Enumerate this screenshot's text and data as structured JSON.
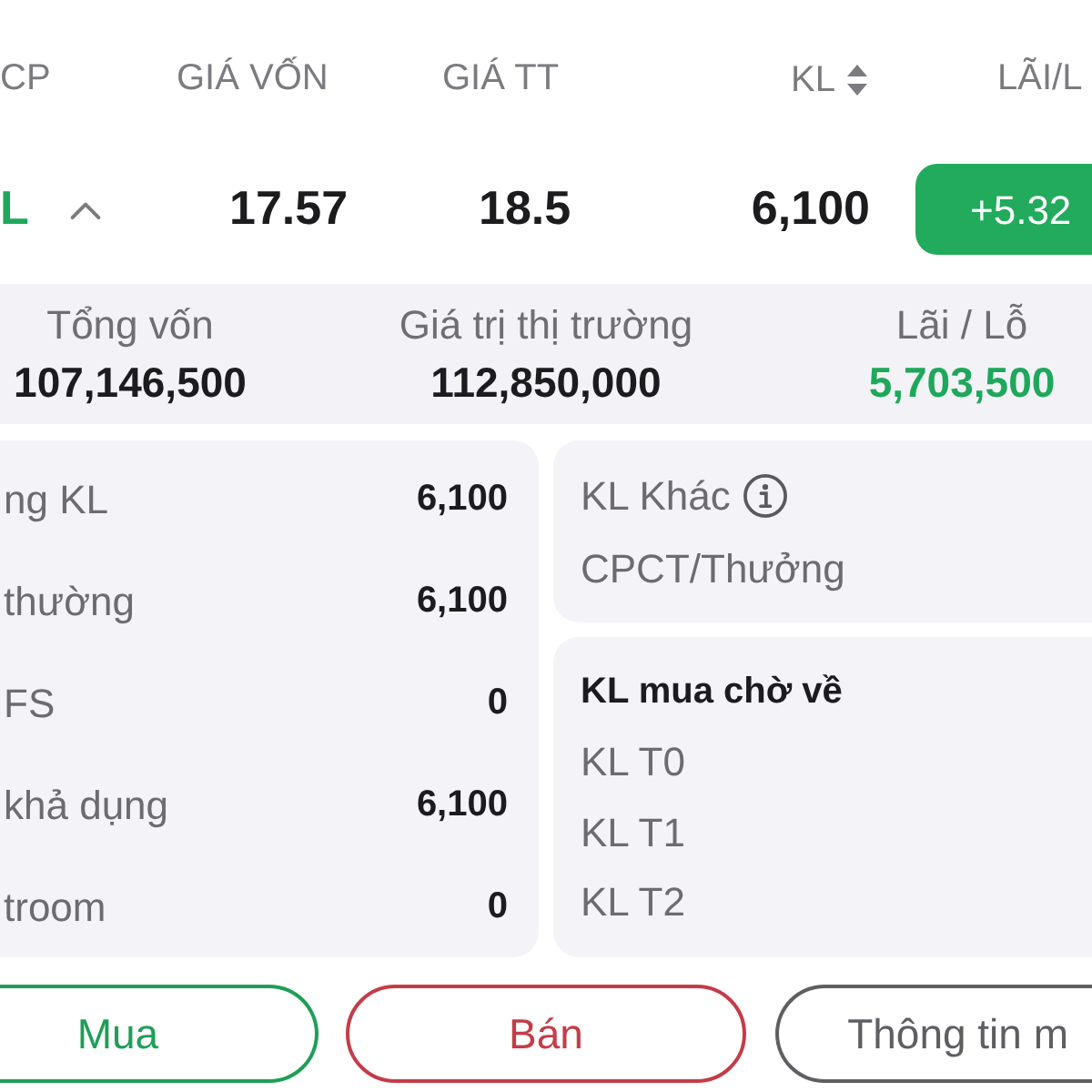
{
  "table": {
    "columns": [
      {
        "label": "CP",
        "sortable": false
      },
      {
        "label": "GIÁ VỐN",
        "sortable": false
      },
      {
        "label": "GIÁ TT",
        "sortable": false
      },
      {
        "label": "KL",
        "sortable": true
      },
      {
        "label": "LÃI/L",
        "sortable": false
      }
    ],
    "rows": [
      {
        "symbol": "L",
        "gain": true,
        "expanded": true,
        "cost_price": "17.57",
        "market_price": "18.5",
        "volume": "6,100",
        "change": "+5.32"
      }
    ]
  },
  "summary": [
    {
      "label": "Tổng vốn",
      "value": "107,146,500",
      "color": "#1c1c1e"
    },
    {
      "label": "Giá trị thị trường",
      "value": "112,850,000",
      "color": "#1c1c1e"
    },
    {
      "label": "Lãi / Lỗ",
      "value": "5,703,500",
      "color": "#1fa75b"
    }
  ],
  "holdings": [
    {
      "label": "ng KL",
      "value": "6,100"
    },
    {
      "label": "thường",
      "value": "6,100"
    },
    {
      "label": "FS",
      "value": "0"
    },
    {
      "label": "khả dụng",
      "value": "6,100"
    },
    {
      "label": "troom",
      "value": "0"
    }
  ],
  "other_volume": {
    "title": "KL Khác",
    "items": [
      "CPCT/Thưởng"
    ]
  },
  "pending_volume": {
    "title": "KL mua chờ về",
    "items": [
      "KL T0",
      "KL T1",
      "KL T2"
    ]
  },
  "actions": [
    {
      "label": "Mua",
      "kind": "buy"
    },
    {
      "label": "Bán",
      "kind": "sell"
    },
    {
      "label": "Thông tin m",
      "kind": "info"
    }
  ]
}
